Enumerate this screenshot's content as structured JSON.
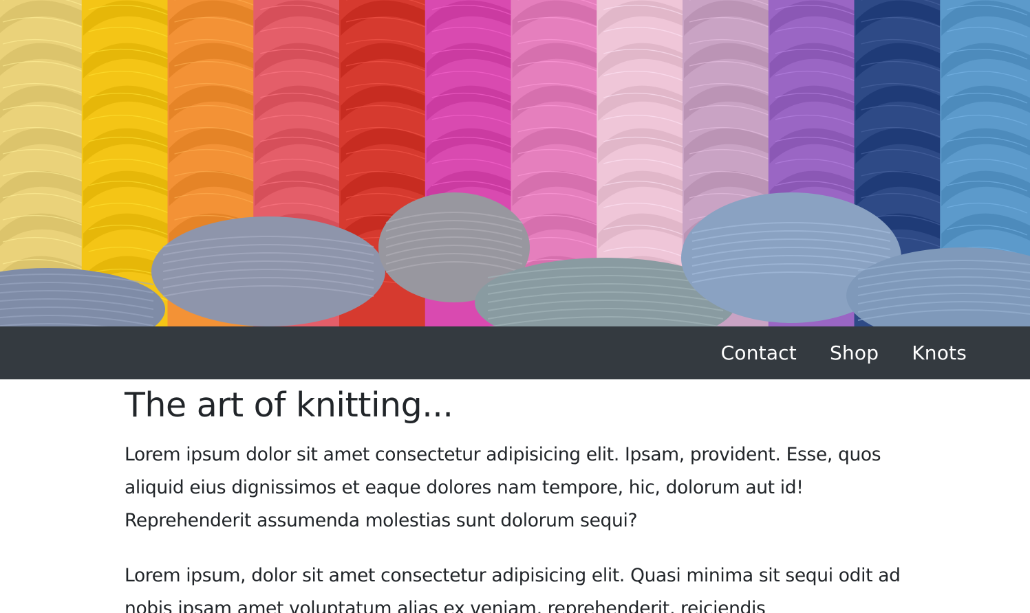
{
  "hero": {
    "colors": {
      "background": "#b9c2cf",
      "skeins": [
        "#ead27a",
        "#f4c516",
        "#f39236",
        "#e45e69",
        "#d63a2f",
        "#d94ab0",
        "#e57fbd",
        "#efc6d8",
        "#c9a3c4",
        "#9a66c4",
        "#2e4a86",
        "#5c9acb"
      ],
      "bottom_skeins": [
        "#7f8ca7",
        "#8e95ab",
        "#98979f",
        "#899ba1",
        "#8aa2c2",
        "#7f99ba"
      ]
    }
  },
  "nav": {
    "background": "#343a40",
    "items": [
      {
        "label": "Contact"
      },
      {
        "label": "Shop"
      },
      {
        "label": "Knots"
      }
    ]
  },
  "main": {
    "title": "The art of knitting...",
    "paragraphs": [
      "Lorem ipsum dolor sit amet consectetur adipisicing elit. Ipsam, provident. Esse, quos aliquid eius dignissimos et eaque dolores nam tempore, hic, dolorum aut id! Reprehenderit assumenda molestias sunt dolorum sequi?",
      "Lorem ipsum, dolor sit amet consectetur adipisicing elit. Quasi minima sit sequi odit ad nobis ipsam amet voluptatum alias ex veniam, reprehenderit, reiciendis"
    ]
  }
}
